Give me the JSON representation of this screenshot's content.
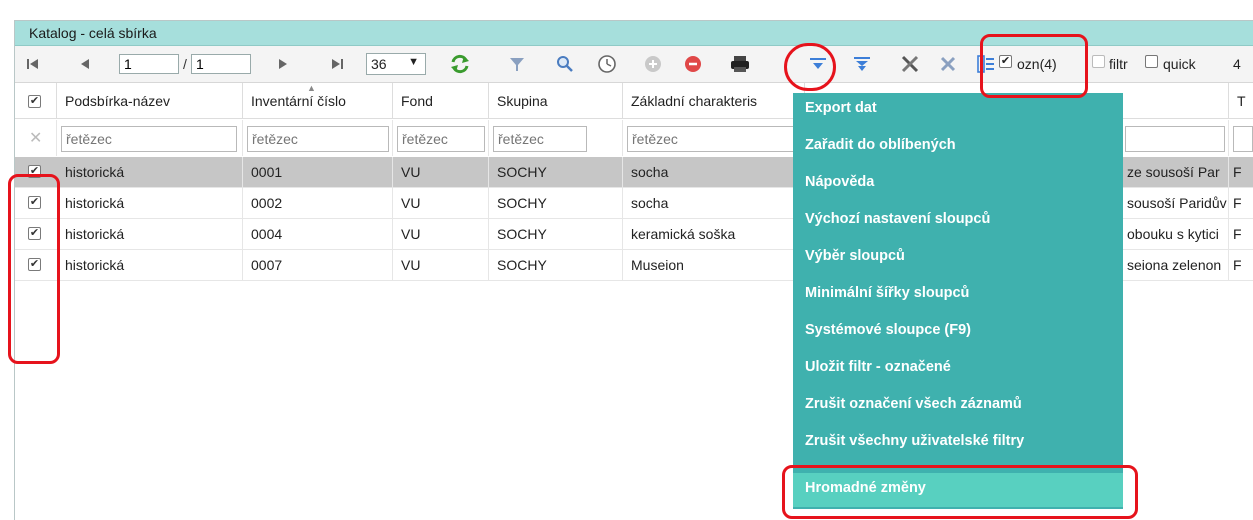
{
  "window": {
    "title": "Katalog - celá sbírka"
  },
  "colors": {
    "accent": "#3fb1ae",
    "title_bar": "#a6dfdc",
    "highlight": "#58d0c0",
    "annotation": "#e6131c"
  },
  "toolbar": {
    "page_current": "1",
    "page_sep": "/",
    "page_total": "1",
    "page_size": "36",
    "icons": [
      "first-page-icon",
      "prev-page-icon",
      "next-page-icon",
      "last-page-icon",
      "refresh-icon",
      "filter-icon",
      "search-icon",
      "clock-icon",
      "add-icon",
      "remove-icon",
      "print-icon",
      "filter-menu-icon",
      "filter-clear-icon",
      "tools-icon",
      "close-icon",
      "columns-icon"
    ],
    "ozn_checked": true,
    "ozn_label": "ozn(4)",
    "filtr_label": "filtr",
    "quick_label": "quick",
    "trailing": "4"
  },
  "columns": [
    "Podsbírka-název",
    "Inventární číslo",
    "Fond",
    "Skupina",
    "Základní charakteris",
    "",
    "T"
  ],
  "filter_placeholder": "řetězec",
  "rows": [
    {
      "checked": true,
      "selected": true,
      "cells": [
        "historická",
        "0001",
        "VU",
        "SOCHY",
        "socha",
        "ze sousoší Par",
        "F"
      ]
    },
    {
      "checked": true,
      "selected": false,
      "cells": [
        "historická",
        "0002",
        "VU",
        "SOCHY",
        "socha",
        "sousoší Paridův",
        "F"
      ]
    },
    {
      "checked": true,
      "selected": false,
      "cells": [
        "historická",
        "0004",
        "VU",
        "SOCHY",
        "keramická soška",
        "obouku s kytici",
        "F"
      ]
    },
    {
      "checked": true,
      "selected": false,
      "cells": [
        "historická",
        "0007",
        "VU",
        "SOCHY",
        "Museion",
        "seiona zelenon",
        "F"
      ]
    }
  ],
  "menu": {
    "items": [
      "Export dat",
      "Zařadit do oblíbených",
      "Nápověda",
      "Výchozí nastavení sloupců",
      "Výběr sloupců",
      "Minimální šířky sloupců",
      "Systémové sloupce (F9)",
      "Uložit filtr - označené",
      "Zrušit označení všech záznamů",
      "Zrušit všechny uživatelské filtry",
      "Hromadné změny"
    ],
    "highlighted_index": 10
  }
}
